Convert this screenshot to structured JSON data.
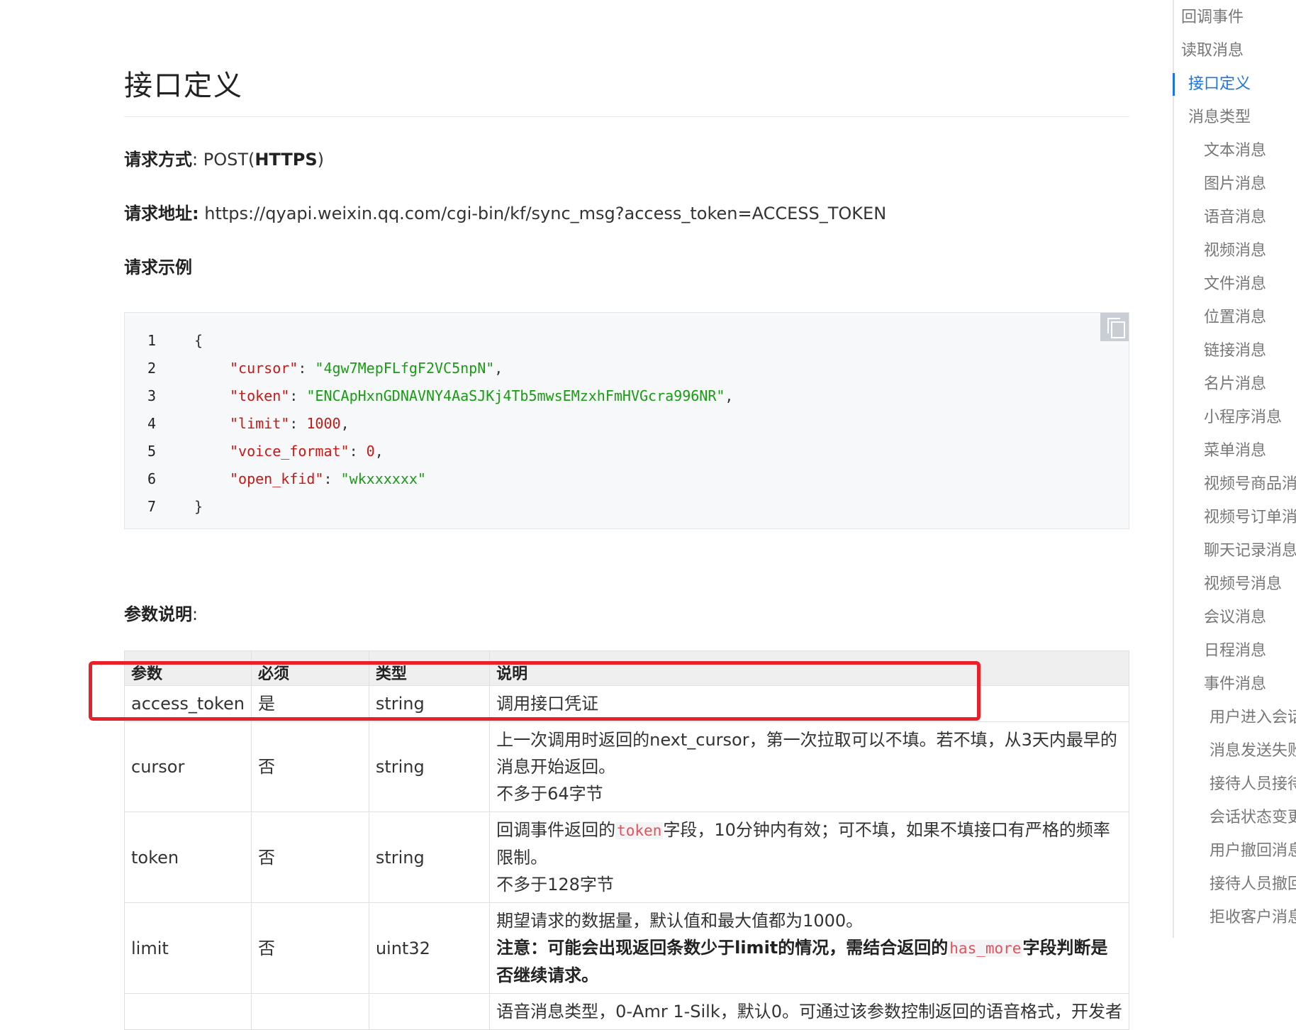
{
  "section": {
    "title": "接口定义"
  },
  "request": {
    "method_label": "请求方式",
    "method_sep": ": POST(",
    "method_strong": "HTTPS",
    "method_close": ")",
    "url_label": "请求地址:",
    "url_value": " https://qyapi.weixin.qq.com/cgi-bin/kf/sync_msg?access_token=ACCESS_TOKEN",
    "example_label": "请求示例"
  },
  "code_lines": [
    {
      "num": "1",
      "open": "{"
    },
    {
      "num": "2",
      "key": "\"cursor\"",
      "val": "\"4gw7MepFLfgF2VC5npN\"",
      "tail": ","
    },
    {
      "num": "3",
      "key": "\"token\"",
      "val": "\"ENCApHxnGDNAVNY4AaSJKj4Tb5mwsEMzxhFmHVGcra996NR\"",
      "tail": ","
    },
    {
      "num": "4",
      "key": "\"limit\"",
      "val": "1000",
      "tail": ","
    },
    {
      "num": "5",
      "key": "\"voice_format\"",
      "val": "0",
      "tail": ","
    },
    {
      "num": "6",
      "key": "\"open_kfid\"",
      "val": "\"wkxxxxxx\"",
      "tail": ""
    },
    {
      "num": "7",
      "open": "}"
    }
  ],
  "params": {
    "label": "参数说明",
    "colon": ":",
    "headers": [
      "参数",
      "必须",
      "类型",
      "说明"
    ],
    "rows": [
      {
        "name": "access_token",
        "required": "是",
        "type": "string",
        "desc": "调用接口凭证"
      },
      {
        "name": "cursor",
        "required": "否",
        "type": "string",
        "desc1": "上一次调用时返回的next_cursor，第一次拉取可以不填。若不填，从3天内最早的消息开始返回。",
        "desc2": "不多于64字节"
      },
      {
        "name": "token",
        "required": "否",
        "type": "string",
        "desc_pre": "回调事件返回的",
        "desc_code": "token",
        "desc_post": "字段，10分钟内有效；可不填，如果不填接口有严格的频率限制。",
        "desc2": "不多于128字节"
      },
      {
        "name": "limit",
        "required": "否",
        "type": "uint32",
        "desc1": "期望请求的数据量，默认值和最大值都为1000。",
        "note_pre": "注意：可能会出现返回条数少于limit的情况，需结合返回的",
        "note_code": "has_more",
        "note_post": "字段判断是否继续请求。"
      },
      {
        "name": "",
        "required": "",
        "type": "",
        "desc1": "语音消息类型，0-Amr 1-Silk，默认0。可通过该参数控制返回的语音格式，开发者"
      }
    ]
  },
  "toc": {
    "items": [
      {
        "label": "回调事件",
        "level": 0
      },
      {
        "label": "读取消息",
        "level": 0
      },
      {
        "label": "接口定义",
        "level": 1,
        "active": true
      },
      {
        "label": "消息类型",
        "level": 1
      },
      {
        "label": "文本消息",
        "level": 2
      },
      {
        "label": "图片消息",
        "level": 2
      },
      {
        "label": "语音消息",
        "level": 2
      },
      {
        "label": "视频消息",
        "level": 2
      },
      {
        "label": "文件消息",
        "level": 2
      },
      {
        "label": "位置消息",
        "level": 2
      },
      {
        "label": "链接消息",
        "level": 2
      },
      {
        "label": "名片消息",
        "level": 2
      },
      {
        "label": "小程序消息",
        "level": 2
      },
      {
        "label": "菜单消息",
        "level": 2
      },
      {
        "label": "视频号商品消",
        "level": 2
      },
      {
        "label": "视频号订单消",
        "level": 2
      },
      {
        "label": "聊天记录消息",
        "level": 2
      },
      {
        "label": "视频号消息",
        "level": 2
      },
      {
        "label": "会议消息",
        "level": 2
      },
      {
        "label": "日程消息",
        "level": 2
      },
      {
        "label": "事件消息",
        "level": 2
      },
      {
        "label": "用户进入会话",
        "level": 3
      },
      {
        "label": "消息发送失败",
        "level": 3
      },
      {
        "label": "接待人员接待",
        "level": 3
      },
      {
        "label": "会话状态变更",
        "level": 3
      },
      {
        "label": "用户撤回消息",
        "level": 3
      },
      {
        "label": "接待人员撤回",
        "level": 3
      },
      {
        "label": "拒收客户消息",
        "level": 3
      }
    ]
  },
  "colors": {
    "accent": "#1f74e0",
    "highlight": "#e8202a",
    "code_key": "#c41a16",
    "code_str": "#1a9b14"
  }
}
